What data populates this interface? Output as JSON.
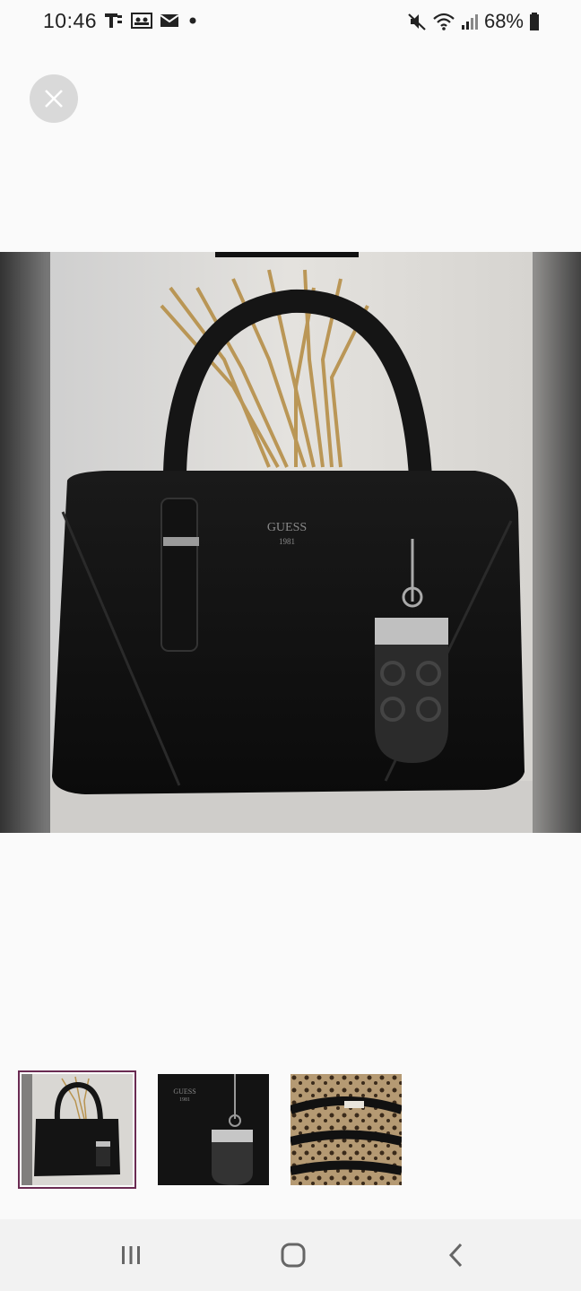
{
  "status_bar": {
    "time": "10:46",
    "battery_percent": "68%",
    "left_icons": [
      "t-icon",
      "contacts-card-icon",
      "mail-icon",
      "dot-icon"
    ],
    "right_icons": [
      "mute-icon",
      "wifi-icon",
      "signal-icon",
      "battery-icon"
    ]
  },
  "viewer": {
    "close_icon": "close-icon",
    "main_image_brand": "GUESS",
    "main_image_year": "1981"
  },
  "thumbnails": [
    {
      "name": "handbag-front",
      "selected": true
    },
    {
      "name": "handbag-logo-closeup",
      "selected": false,
      "brand": "GUESS",
      "year": "1981"
    },
    {
      "name": "handbag-interior",
      "selected": false
    }
  ],
  "nav_bar": {
    "icons": [
      "recent-apps-icon",
      "home-icon",
      "back-icon"
    ]
  },
  "colors": {
    "background": "#fafafa",
    "selected_thumb_border": "#6a2b52",
    "close_button_bg": "#d9d9d9",
    "nav_bar_bg": "#f2f2f2"
  }
}
